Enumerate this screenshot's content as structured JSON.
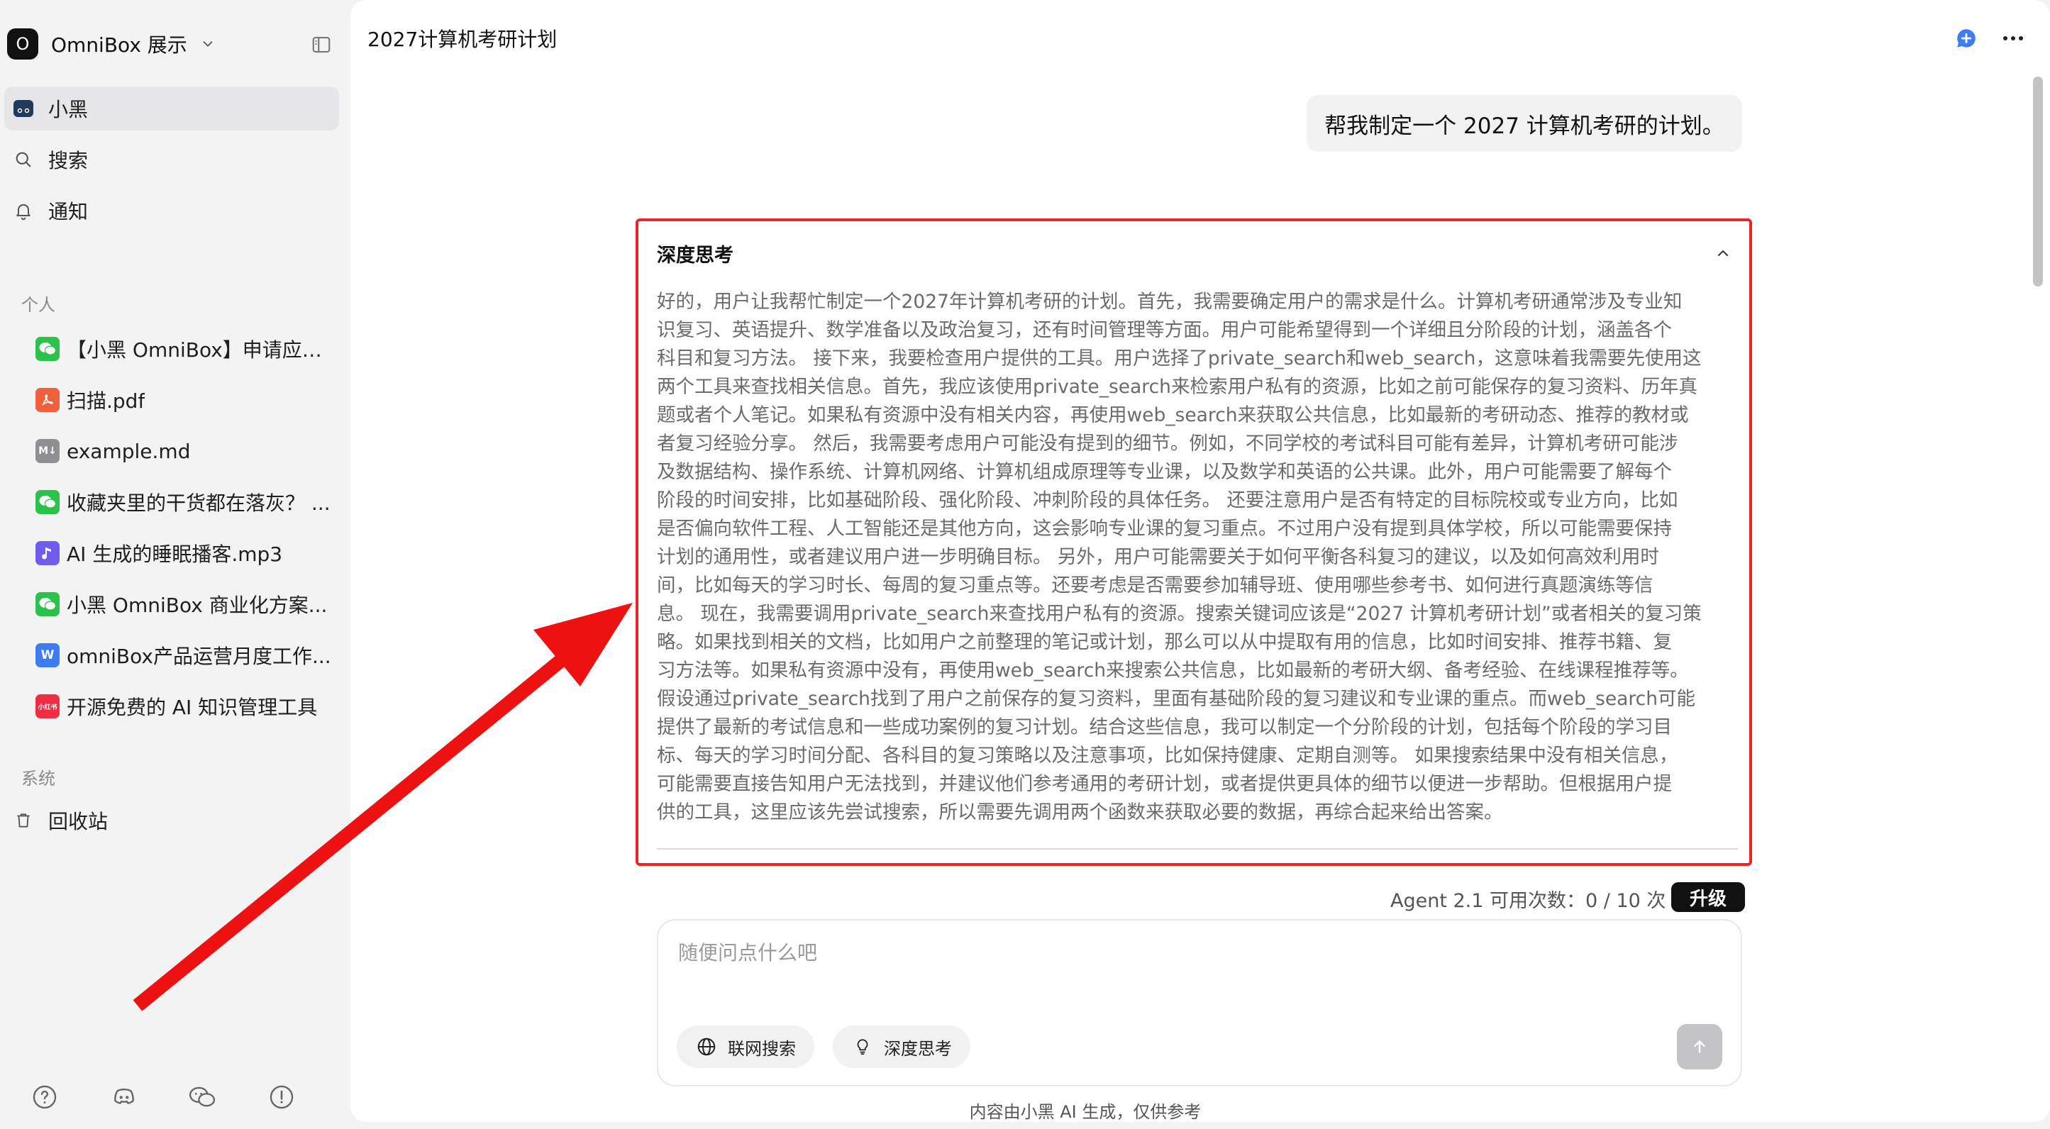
{
  "workspace": {
    "logo": "O",
    "name": "OmniBox 展示"
  },
  "nav": [
    {
      "label": "小黑",
      "icon": "cat-avatar-icon",
      "active": true
    },
    {
      "label": "搜索",
      "icon": "search-icon"
    },
    {
      "label": "通知",
      "icon": "bell-icon"
    }
  ],
  "sections": {
    "personal": "个人",
    "system": "系统"
  },
  "docs": [
    {
      "label": "【小黑 OmniBox】申请应聘...",
      "icon": "wechat-icon",
      "color": "#2bc24b"
    },
    {
      "label": "扫描.pdf",
      "icon": "pdf-icon",
      "color": "#f0603c"
    },
    {
      "label": "example.md",
      "icon": "markdown-icon",
      "color": "#8e8e93"
    },
    {
      "label": "收藏夹里的干货都在落灰？ ...",
      "icon": "wechat-icon",
      "color": "#2bc24b"
    },
    {
      "label": "AI 生成的睡眠播客.mp3",
      "icon": "audio-icon",
      "color": "#6e5bf0"
    },
    {
      "label": "小黑 OmniBox 商业化方案...",
      "icon": "wechat-icon",
      "color": "#2bc24b"
    },
    {
      "label": "omniBox产品运营月度工作...",
      "icon": "word-icon",
      "color": "#3d7cf5"
    },
    {
      "label": "开源免费的 AI 知识管理工具",
      "icon": "xiaohongshu-icon",
      "color": "#ef2e43",
      "badge": "小红书"
    }
  ],
  "system_items": [
    {
      "label": "回收站",
      "icon": "trash-icon"
    }
  ],
  "footer_icons": [
    "help-icon",
    "discord-icon",
    "wechat-icon",
    "feedback-icon"
  ],
  "chat": {
    "title": "2027计算机考研计划",
    "user_message": "帮我制定一个 2027 计算机考研的计划。",
    "thinking_title": "深度思考",
    "thinking_lines": [
      "好的，用户让我帮忙制定一个2027年计算机考研的计划。首先，我需要确定用户的需求是什么。计算机考研通常涉及专业知",
      "识复习、英语提升、数学准备以及政治复习，还有时间管理等方面。用户可能希望得到一个详细且分阶段的计划，涵盖各个",
      "科目和复习方法。 接下来，我要检查用户提供的工具。用户选择了private_search和web_search，这意味着我需要先使用这",
      "两个工具来查找相关信息。首先，我应该使用private_search来检索用户私有的资源，比如之前可能保存的复习资料、历年真",
      "题或者个人笔记。如果私有资源中没有相关内容，再使用web_search来获取公共信息，比如最新的考研动态、推荐的教材或",
      "者复习经验分享。 然后，我需要考虑用户可能没有提到的细节。例如，不同学校的考试科目可能有差异，计算机考研可能涉",
      "及数据结构、操作系统、计算机网络、计算机组成原理等专业课，以及数学和英语的公共课。此外，用户可能需要了解每个",
      "阶段的时间安排，比如基础阶段、强化阶段、冲刺阶段的具体任务。 还要注意用户是否有特定的目标院校或专业方向，比如",
      "是否偏向软件工程、人工智能还是其他方向，这会影响专业课的复习重点。不过用户没有提到具体学校，所以可能需要保持",
      "计划的通用性，或者建议用户进一步明确目标。 另外，用户可能需要关于如何平衡各科复习的建议，以及如何高效利用时",
      "间，比如每天的学习时长、每周的复习重点等。还要考虑是否需要参加辅导班、使用哪些参考书、如何进行真题演练等信",
      "息。 现在，我需要调用private_search来查找用户私有的资源。搜索关键词应该是“2027 计算机考研计划”或者相关的复习策",
      "略。如果找到相关的文档，比如用户之前整理的笔记或计划，那么可以从中提取有用的信息，比如时间安排、推荐书籍、复",
      "习方法等。如果私有资源中没有，再使用web_search来搜索公共信息，比如最新的考研大纲、备考经验、在线课程推荐等。",
      "假设通过private_search找到了用户之前保存的复习资料，里面有基础阶段的复习建议和专业课的重点。而web_search可能",
      "提供了最新的考试信息和一些成功案例的复习计划。结合这些信息，我可以制定一个分阶段的计划，包括每个阶段的学习目",
      "标、每天的学习时间分配、各科目的复习策略以及注意事项，比如保持健康、定期自测等。 如果搜索结果中没有相关信息，",
      "可能需要直接告知用户无法找到，并建议他们参考通用的考研计划，或者提供更具体的细节以便进一步帮助。但根据用户提",
      "供的工具，这里应该先尝试搜索，所以需要先调用两个函数来获取必要的数据，再综合起来给出答案。"
    ],
    "quota_text": "Agent 2.1 可用次数：0 / 10 次",
    "upgrade_label": "升级",
    "input_placeholder": "随便问点什么吧",
    "input_value": "",
    "web_search_label": "联网搜索",
    "deep_think_label": "深度思考",
    "disclaimer": "内容由小黑 AI 生成，仅供参考"
  },
  "annotation": {
    "color": "#e8262a",
    "shape": "arrow-pointing-to-thinking-box"
  }
}
